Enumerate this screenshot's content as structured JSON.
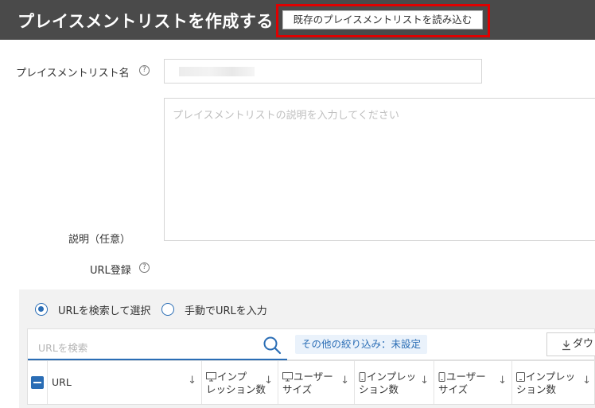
{
  "header": {
    "title": "プレイスメントリストを作成する",
    "import_button": "既存のプレイスメントリストを読み込む"
  },
  "form": {
    "name_label": "プレイスメントリスト名",
    "name_value": "",
    "description_label": "説明（任意）",
    "description_placeholder": "プレイスメントリストの説明を入力してください",
    "url_label": "URL登録",
    "help_glyph": "?"
  },
  "url_panel": {
    "radio_search": "URLを検索して選択",
    "radio_manual": "手動でURLを入力",
    "search_placeholder": "URLを検索",
    "filter_chip": "その他の絞り込み：未設定",
    "download_label": "ダウ"
  },
  "table": {
    "columns": [
      {
        "line1": "URL",
        "line2": "",
        "icon": "none"
      },
      {
        "line1": "インプ",
        "line2": "レッション数",
        "icon": "desktop-icon"
      },
      {
        "line1": "ユーザー",
        "line2": "サイズ",
        "icon": "desktop-icon"
      },
      {
        "line1": "インプレッ",
        "line2": "ション数",
        "icon": "mobile-icon"
      },
      {
        "line1": "ユーザー",
        "line2": "サイズ",
        "icon": "mobile-icon"
      },
      {
        "line1": "インプレッ",
        "line2": "ション数",
        "icon": "tablet-icon"
      }
    ],
    "sort_glyph": "↓"
  },
  "colors": {
    "header_bg": "#4a4a4a",
    "highlight": "#e00000",
    "accent": "#2a6db5",
    "panel_bg": "#f2f2f2"
  }
}
